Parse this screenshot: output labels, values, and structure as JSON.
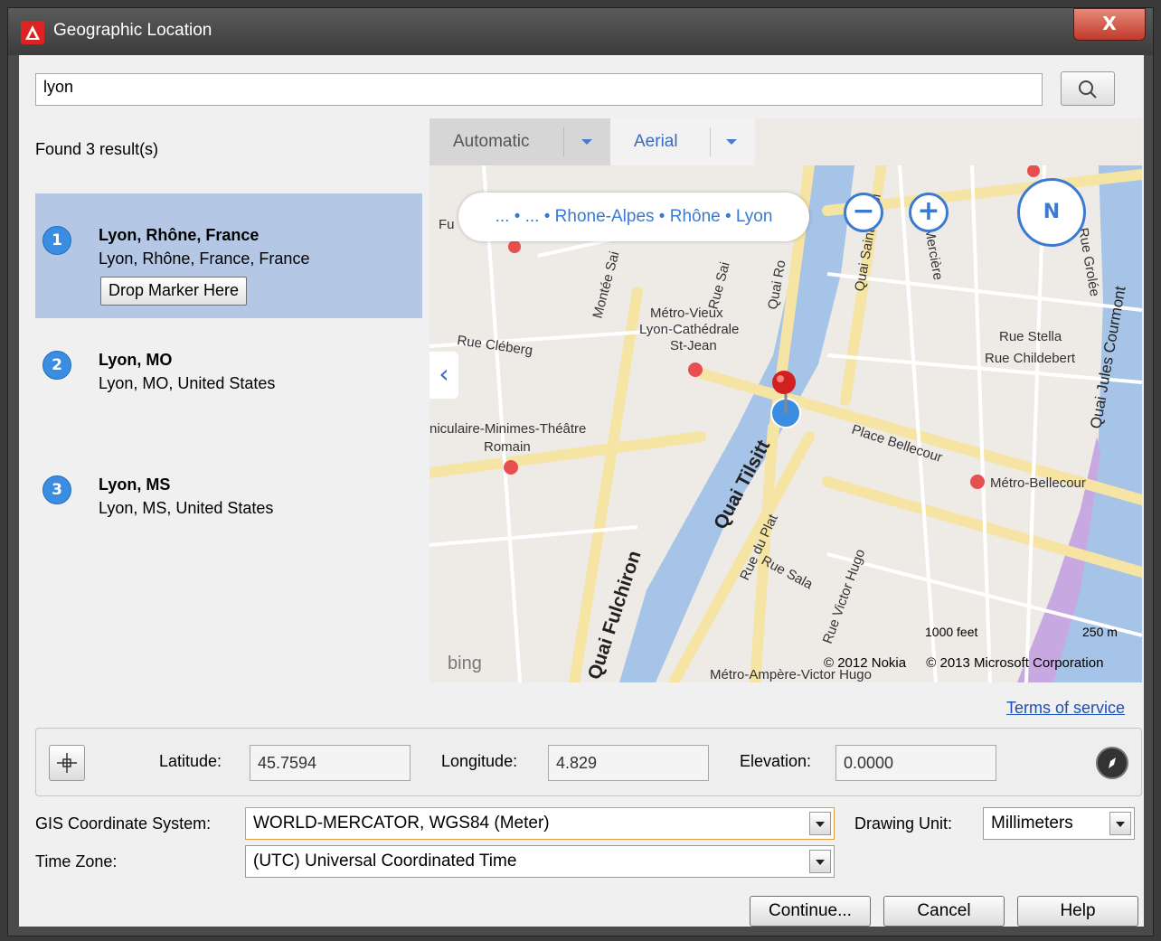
{
  "window": {
    "title": "Geographic Location",
    "close_label": "X"
  },
  "search": {
    "value": "lyon",
    "placeholder": ""
  },
  "results": {
    "found_text": "Found 3 result(s)",
    "items": [
      {
        "index": "1",
        "title": "Lyon, Rhône, France",
        "subtitle": "Lyon, Rhône, France, France",
        "selected": true,
        "button": "Drop Marker Here"
      },
      {
        "index": "2",
        "title": "Lyon, MO",
        "subtitle": "Lyon, MO, United States"
      },
      {
        "index": "3",
        "title": "Lyon, MS",
        "subtitle": "Lyon, MS, United States"
      }
    ]
  },
  "map": {
    "tabs": [
      {
        "label": "Automatic"
      },
      {
        "label": "Aerial"
      }
    ],
    "breadcrumb": "... • ... • Rhone-Alpes • Rhône • Lyon",
    "zoom_out": "−",
    "zoom_in": "+",
    "compass": "N",
    "collapse": "‹",
    "labels": {
      "metro_vieux": "Métro-Vieux",
      "lyon_cathedrale": "Lyon-Cathédrale",
      "st_jean": "St-Jean",
      "rue_cleberg": "Rue Cléberg",
      "quai_tilsitt": "Quai Tilsitt",
      "quai_fulchiron": "Quai Fulchiron",
      "place_bellecour": "Place Bellecour",
      "metro_bellecour": "Métro-Bellecour",
      "rue_stella": "Rue Stella",
      "rue_childebert": "Rue Childebert",
      "quai_jules_courmont": "Quai Jules Courmont",
      "quai_saint_antoine": "Quai Saint-Antoi",
      "mercière": "Mercière",
      "rue_grolee": "Rue Grolée",
      "funiculaire": "niculaire-Minimes-Théâtre",
      "romain": "Romain",
      "montee": "Montée Sai",
      "rue_sai": "Rue Sai",
      "quai_ro": "Quai Ro",
      "rue_du_plat": "Rue du Plat",
      "rue_sala": "Rue Sala",
      "rue_victor_hugo": "Rue Victor Hugo",
      "metro_ampere": "Métro-Ampère-Victor Hugo",
      "fu": "Fu"
    },
    "scale_feet": "1000 feet",
    "scale_m": "250 m",
    "bing": "bing",
    "copyright_nokia": "© 2012 Nokia",
    "copyright_ms": "© 2013 Microsoft Corporation"
  },
  "terms": "Terms of service",
  "coords": {
    "latitude_label": "Latitude:",
    "latitude": "45.7594",
    "longitude_label": "Longitude:",
    "longitude": "4.829",
    "elevation_label": "Elevation:",
    "elevation": "0.0000"
  },
  "gis": {
    "label": "GIS Coordinate System:",
    "value": "WORLD-MERCATOR, WGS84 (Meter)"
  },
  "drawing_unit": {
    "label": "Drawing Unit:",
    "value": "Millimeters"
  },
  "time_zone": {
    "label": "Time Zone:",
    "value": "(UTC) Universal Coordinated Time"
  },
  "buttons": {
    "continue": "Continue...",
    "cancel": "Cancel",
    "help": "Help"
  },
  "colors": {
    "accent": "#3a7ad0",
    "selection": "#b4c8e6",
    "river": "#a6c3e8",
    "road": "#f6e4a4"
  }
}
